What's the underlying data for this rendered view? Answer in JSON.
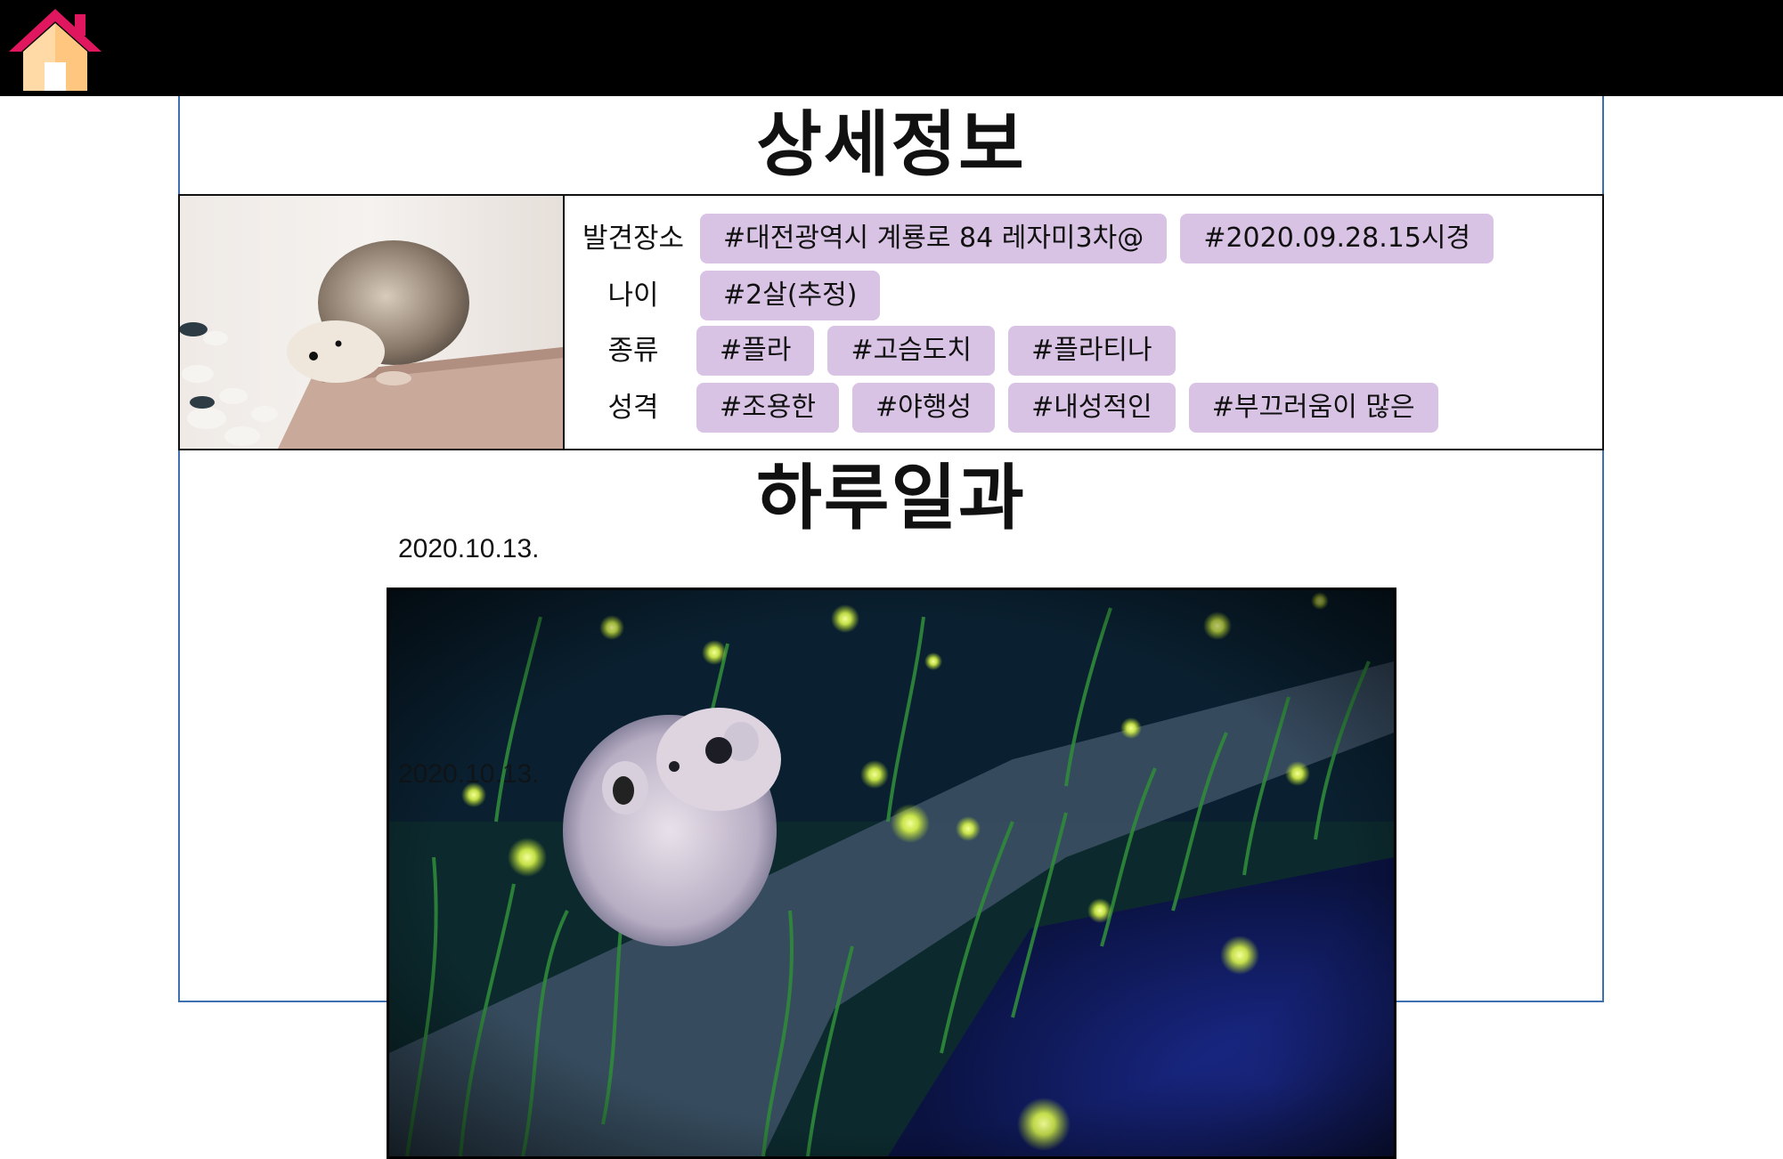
{
  "header": {
    "home_icon": "home-icon"
  },
  "detail": {
    "title": "상세정보",
    "photo_icon": "hedgehog-photo",
    "rows": [
      {
        "label": "발견장소",
        "tags": [
          "#대전광역시 계룡로 84 레자미3차@",
          "#2020.09.28.15시경"
        ]
      },
      {
        "label": "나이",
        "tags": [
          "#2살(추정)"
        ]
      },
      {
        "label": "종류",
        "tags": [
          "#플라",
          "#고슴도치",
          "#플라티나"
        ]
      },
      {
        "label": "성격",
        "tags": [
          "#조용한",
          "#야행성",
          "#내성적인",
          "#부끄러움이 많은"
        ]
      }
    ]
  },
  "daily": {
    "title": "하루일과",
    "date": "2020.10.13.",
    "date_ghost": "2020.10.13.",
    "photo_icon": "hedgehog-firefly-photo"
  },
  "colors": {
    "tag_bg": "#d9c3e5",
    "panel_border": "#3d6fb1",
    "topbar": "#000000"
  }
}
